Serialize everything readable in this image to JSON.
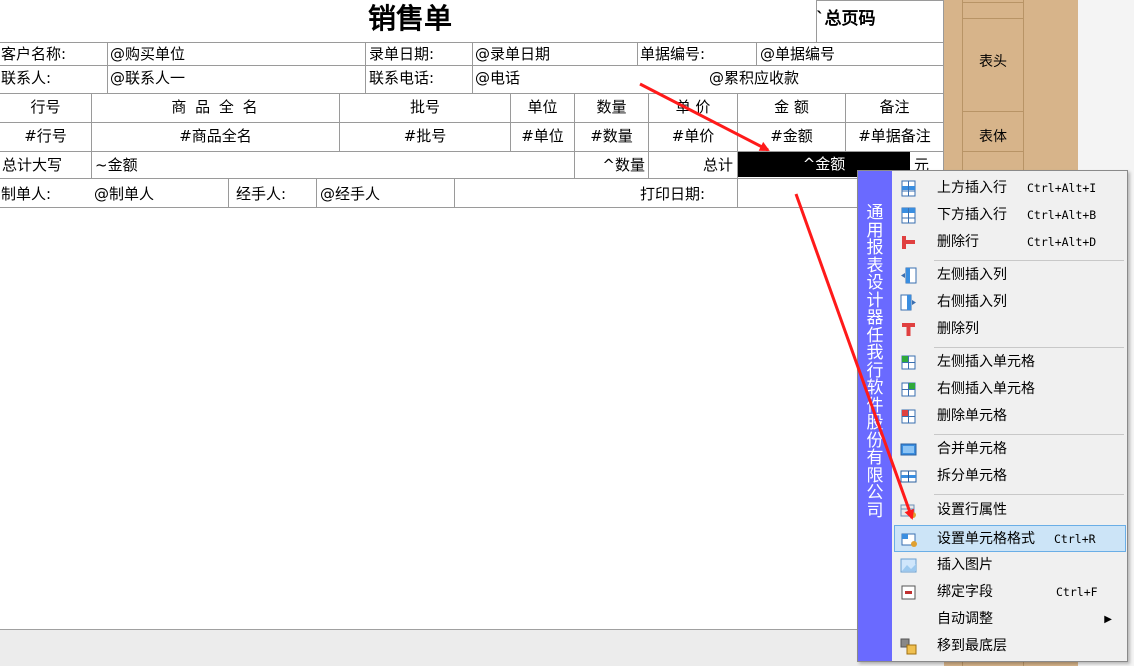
{
  "report": {
    "title": "销售单",
    "page_code": "`总页码",
    "header_row1": {
      "customer_label": "客户名称:",
      "customer_value": "@购买单位",
      "date_label": "录单日期:",
      "date_value": "@录单日期",
      "number_label": "单据编号:",
      "number_value": "@单据编号"
    },
    "header_row2": {
      "contact_label": "联系人:",
      "contact_value": "@联系人一",
      "phone_label": "联系电话:",
      "phone_value": "@电话",
      "receivable_value": "@累积应收款"
    },
    "columns": [
      "行号",
      "商 品 全 名",
      "批号",
      "单位",
      "数量",
      "单 价",
      "金 额",
      "备注"
    ],
    "body_fields": [
      "#行号",
      "#商品全名",
      "#批号",
      "#单位",
      "#数量",
      "#单价",
      "#金额",
      "#单据备注"
    ],
    "total_row": {
      "uppercase_label": "总计大写",
      "uppercase_value": "~金额",
      "qty_value": "^数量",
      "total_label": "总计",
      "amount_value": "^金额",
      "unit": "元"
    },
    "footer_row": {
      "maker_label": "制单人:",
      "maker_value": "@制单人",
      "handler_label": "经手人:",
      "handler_value": "@经手人",
      "print_date_label": "打印日期:"
    }
  },
  "right_panel": {
    "header_label": "表头",
    "body_label": "表体"
  },
  "context_menu": {
    "side_title": "通用报表设计器  任我行软件股份有限公司",
    "items": [
      {
        "label": "上方插入行",
        "shortcut": "Ctrl+Alt+I",
        "icon": "insert-row-above-icon"
      },
      {
        "label": "下方插入行",
        "shortcut": "Ctrl+Alt+B",
        "icon": "insert-row-below-icon"
      },
      {
        "label": "删除行",
        "shortcut": "Ctrl+Alt+D",
        "icon": "delete-row-icon"
      },
      {
        "label": "左侧插入列",
        "shortcut": "",
        "icon": "insert-col-left-icon"
      },
      {
        "label": "右侧插入列",
        "shortcut": "",
        "icon": "insert-col-right-icon"
      },
      {
        "label": "删除列",
        "shortcut": "",
        "icon": "delete-col-icon"
      },
      {
        "label": "左侧插入单元格",
        "shortcut": "",
        "icon": "insert-cell-left-icon"
      },
      {
        "label": "右侧插入单元格",
        "shortcut": "",
        "icon": "insert-cell-right-icon"
      },
      {
        "label": "删除单元格",
        "shortcut": "",
        "icon": "delete-cell-icon"
      },
      {
        "label": "合并单元格",
        "shortcut": "",
        "icon": "merge-cells-icon"
      },
      {
        "label": "拆分单元格",
        "shortcut": "",
        "icon": "split-cells-icon"
      },
      {
        "label": "设置行属性",
        "shortcut": "",
        "icon": "row-properties-icon"
      },
      {
        "label": "设置单元格格式",
        "shortcut": "Ctrl+R",
        "icon": "cell-format-icon"
      },
      {
        "label": "插入图片",
        "shortcut": "",
        "icon": "insert-image-icon"
      },
      {
        "label": "绑定字段",
        "shortcut": "Ctrl+F",
        "icon": "bind-field-icon"
      },
      {
        "label": "自动调整",
        "shortcut": "",
        "icon": ""
      },
      {
        "label": "移到最底层",
        "shortcut": "",
        "icon": "send-to-back-icon"
      }
    ]
  },
  "colors": {
    "menu_side": "#6a6aff",
    "selection": "#cce4f7",
    "panel": "#d7b48a",
    "arrow": "#ff1a1a"
  }
}
